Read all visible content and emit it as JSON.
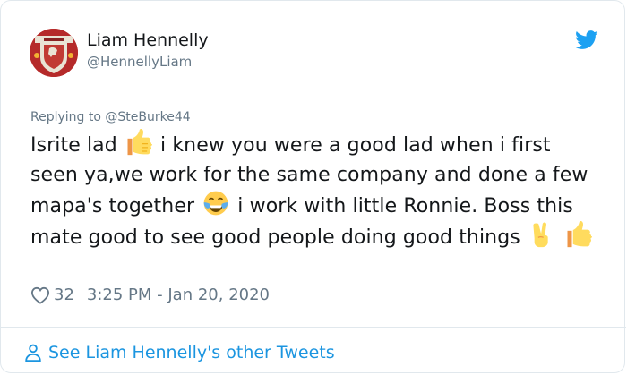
{
  "author": {
    "name": "Liam Hennelly",
    "handle": "@HennellyLiam",
    "avatar_icon": "liverpool-crest-avatar"
  },
  "reply": {
    "prefix": "Replying to ",
    "to": "@SteBurke44"
  },
  "tweet": {
    "part1": "Isrite lad",
    "part2": "i knew you were a good lad when i first seen ya,we work for the same company and done a few mapa's together",
    "part3": "i work with little Ronnie. Boss this mate good to see good people doing good things",
    "emojis": [
      "thumbs-up",
      "tears-of-joy",
      "victory-hand",
      "thumbs-up"
    ]
  },
  "meta": {
    "likes": "32",
    "timestamp": "3:25 PM - Jan 20, 2020"
  },
  "footer": {
    "more_link": "See Liam Hennelly's other Tweets"
  },
  "colors": {
    "accent": "#1b95e0",
    "muted": "#657786",
    "text": "#14171a",
    "border": "#e1e8ed"
  }
}
